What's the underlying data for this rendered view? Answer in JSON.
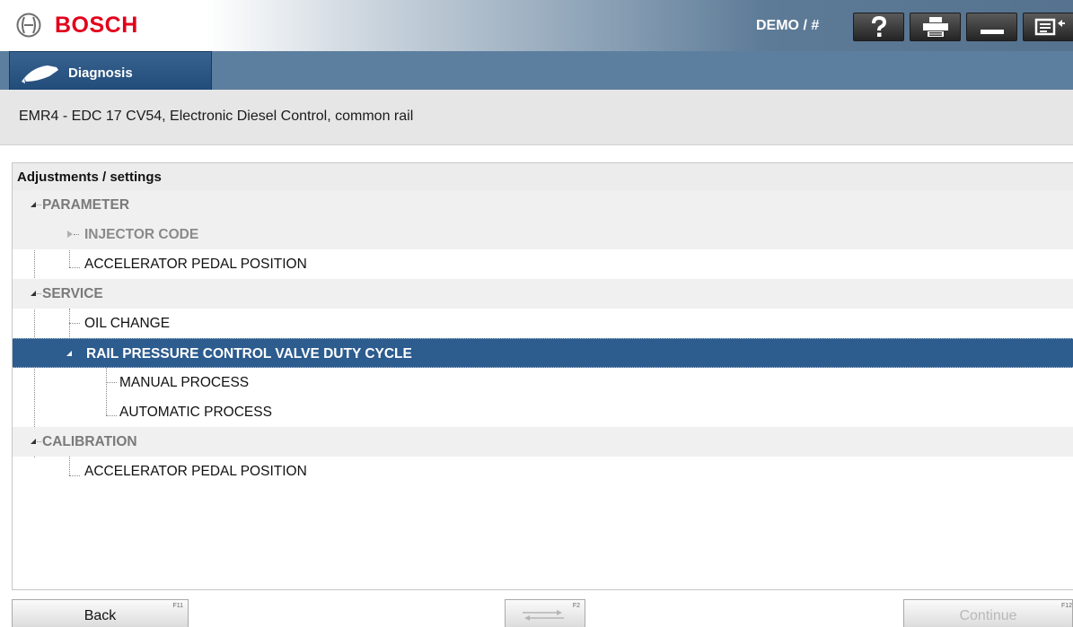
{
  "header": {
    "brand": "BOSCH",
    "session_label": "DEMO / #",
    "toolbar_icons": [
      "help-icon",
      "print-icon",
      "minimize-icon",
      "menu-exit-icon"
    ]
  },
  "tab": {
    "label": "Diagnosis",
    "icon": "diagnosis-plug-icon"
  },
  "subtitle": "EMR4 - EDC 17 CV54, Electronic Diesel Control, common rail",
  "panel": {
    "title": "Adjustments / settings",
    "tree": [
      {
        "label": "PARAMETER",
        "kind": "group",
        "expanded": true
      },
      {
        "label": "INJECTOR CODE",
        "kind": "disabled",
        "expanded": false
      },
      {
        "label": "ACCELERATOR PEDAL POSITION",
        "kind": "item"
      },
      {
        "label": "SERVICE",
        "kind": "group",
        "expanded": true
      },
      {
        "label": "OIL CHANGE",
        "kind": "item"
      },
      {
        "label": "RAIL PRESSURE CONTROL VALVE DUTY CYCLE",
        "kind": "selected",
        "expanded": true
      },
      {
        "label": "MANUAL PROCESS",
        "kind": "item"
      },
      {
        "label": "AUTOMATIC PROCESS",
        "kind": "item"
      },
      {
        "label": "CALIBRATION",
        "kind": "group",
        "expanded": true
      },
      {
        "label": "ACCELERATOR PEDAL POSITION",
        "kind": "item"
      }
    ]
  },
  "footer": {
    "back_label": "Back",
    "back_key": "F11",
    "switch_key": "F2",
    "continue_label": "Continue",
    "continue_key": "F12"
  },
  "colors": {
    "brand_red": "#e2001a",
    "tab_blue": "#2a5585",
    "selection_blue": "#2d5c8e",
    "header_slate": "#5d7f9f"
  }
}
